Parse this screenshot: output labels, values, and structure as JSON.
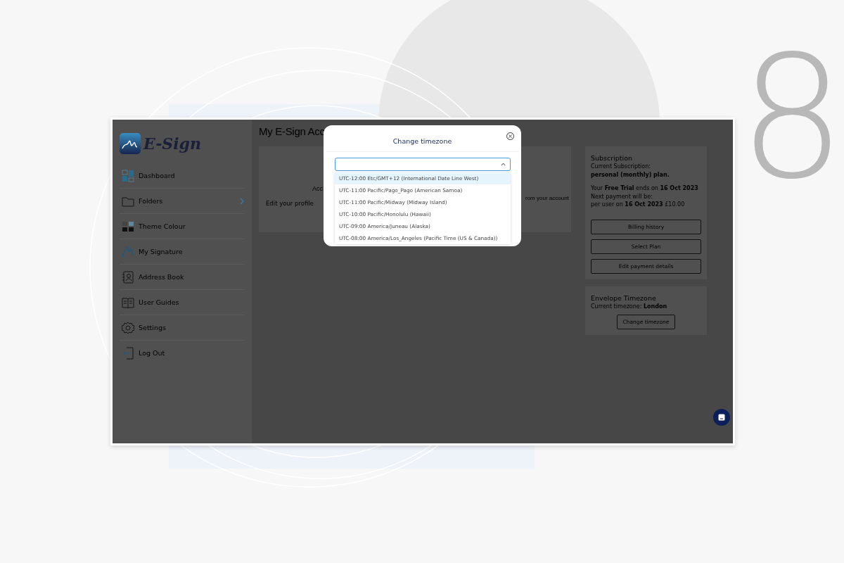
{
  "backdrop": {
    "step_number": "8"
  },
  "sidebar": {
    "logo_text": "E-Sign",
    "items": [
      {
        "label": "Dashboard",
        "expandable": false
      },
      {
        "label": "Folders",
        "expandable": true
      },
      {
        "label": "Theme Colour",
        "expandable": false
      },
      {
        "label": "My Signature",
        "expandable": false
      },
      {
        "label": "Address Book",
        "expandable": false
      },
      {
        "label": "User Guides",
        "expandable": false
      },
      {
        "label": "Settings",
        "expandable": false
      },
      {
        "label": "Log Out",
        "expandable": false
      }
    ]
  },
  "main": {
    "title": "My E-Sign Acc",
    "profile_card": {
      "heading": "Acc",
      "link": "Edit your profile",
      "note": "rom your account"
    }
  },
  "subscription": {
    "title": "Subscription",
    "lines": [
      "Current Subscription:",
      "**personal (monthly) plan.**"
    ],
    "trial_lines": [
      "Your **Free Trial** ends on **16 Oct 2023**",
      "Next payment will be:",
      "per user on **16 Oct 2023**  £10.00"
    ],
    "buttons": [
      "Billing history",
      "Select Plan",
      "Edit payment details"
    ]
  },
  "timezone_card": {
    "title": "Envelope Timezone",
    "current": "Current timezone: **London**",
    "button": "Change timezone"
  },
  "modal": {
    "title": "Change timezone",
    "select": {
      "expanded": true
    },
    "options": [
      {
        "label": "UTC-12:00 Etc/GMT+12 (International Date Line West)",
        "selected": true
      },
      {
        "label": "UTC-11:00 Pacific/Pago_Pago (American Samoa)",
        "selected": false
      },
      {
        "label": "UTC-11:00 Pacific/Midway (Midway Island)",
        "selected": false
      },
      {
        "label": "UTC-10:00 Pacific/Honolulu (Hawaii)",
        "selected": false
      },
      {
        "label": "UTC-09:00 America/Juneau (Alaska)",
        "selected": false
      },
      {
        "label": "UTC-08:00 America/Los_Angeles (Pacific Time (US & Canada))",
        "selected": false
      }
    ]
  }
}
